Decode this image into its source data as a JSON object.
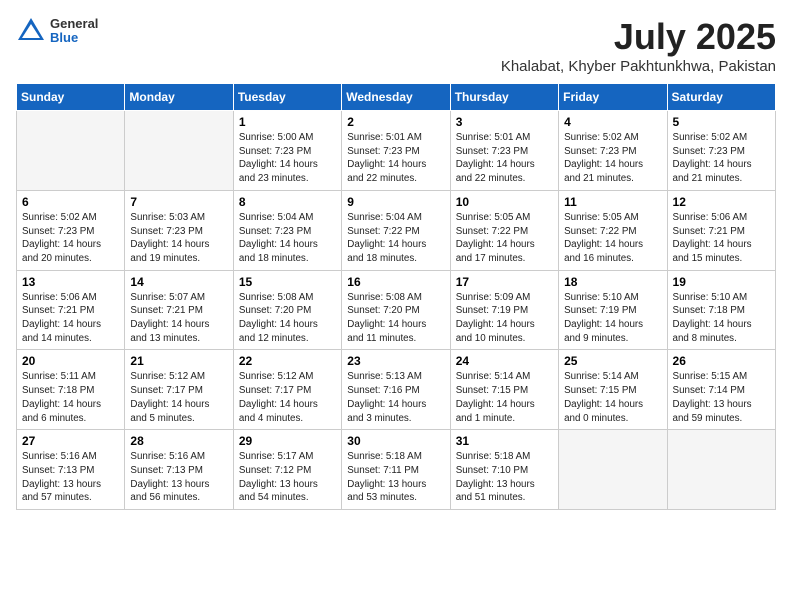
{
  "header": {
    "logo_general": "General",
    "logo_blue": "Blue",
    "month": "July 2025",
    "location": "Khalabat, Khyber Pakhtunkhwa, Pakistan"
  },
  "days_of_week": [
    "Sunday",
    "Monday",
    "Tuesday",
    "Wednesday",
    "Thursday",
    "Friday",
    "Saturday"
  ],
  "weeks": [
    [
      {
        "day": null
      },
      {
        "day": null
      },
      {
        "day": "1",
        "sunrise": "Sunrise: 5:00 AM",
        "sunset": "Sunset: 7:23 PM",
        "daylight": "Daylight: 14 hours and 23 minutes."
      },
      {
        "day": "2",
        "sunrise": "Sunrise: 5:01 AM",
        "sunset": "Sunset: 7:23 PM",
        "daylight": "Daylight: 14 hours and 22 minutes."
      },
      {
        "day": "3",
        "sunrise": "Sunrise: 5:01 AM",
        "sunset": "Sunset: 7:23 PM",
        "daylight": "Daylight: 14 hours and 22 minutes."
      },
      {
        "day": "4",
        "sunrise": "Sunrise: 5:02 AM",
        "sunset": "Sunset: 7:23 PM",
        "daylight": "Daylight: 14 hours and 21 minutes."
      },
      {
        "day": "5",
        "sunrise": "Sunrise: 5:02 AM",
        "sunset": "Sunset: 7:23 PM",
        "daylight": "Daylight: 14 hours and 21 minutes."
      }
    ],
    [
      {
        "day": "6",
        "sunrise": "Sunrise: 5:02 AM",
        "sunset": "Sunset: 7:23 PM",
        "daylight": "Daylight: 14 hours and 20 minutes."
      },
      {
        "day": "7",
        "sunrise": "Sunrise: 5:03 AM",
        "sunset": "Sunset: 7:23 PM",
        "daylight": "Daylight: 14 hours and 19 minutes."
      },
      {
        "day": "8",
        "sunrise": "Sunrise: 5:04 AM",
        "sunset": "Sunset: 7:23 PM",
        "daylight": "Daylight: 14 hours and 18 minutes."
      },
      {
        "day": "9",
        "sunrise": "Sunrise: 5:04 AM",
        "sunset": "Sunset: 7:22 PM",
        "daylight": "Daylight: 14 hours and 18 minutes."
      },
      {
        "day": "10",
        "sunrise": "Sunrise: 5:05 AM",
        "sunset": "Sunset: 7:22 PM",
        "daylight": "Daylight: 14 hours and 17 minutes."
      },
      {
        "day": "11",
        "sunrise": "Sunrise: 5:05 AM",
        "sunset": "Sunset: 7:22 PM",
        "daylight": "Daylight: 14 hours and 16 minutes."
      },
      {
        "day": "12",
        "sunrise": "Sunrise: 5:06 AM",
        "sunset": "Sunset: 7:21 PM",
        "daylight": "Daylight: 14 hours and 15 minutes."
      }
    ],
    [
      {
        "day": "13",
        "sunrise": "Sunrise: 5:06 AM",
        "sunset": "Sunset: 7:21 PM",
        "daylight": "Daylight: 14 hours and 14 minutes."
      },
      {
        "day": "14",
        "sunrise": "Sunrise: 5:07 AM",
        "sunset": "Sunset: 7:21 PM",
        "daylight": "Daylight: 14 hours and 13 minutes."
      },
      {
        "day": "15",
        "sunrise": "Sunrise: 5:08 AM",
        "sunset": "Sunset: 7:20 PM",
        "daylight": "Daylight: 14 hours and 12 minutes."
      },
      {
        "day": "16",
        "sunrise": "Sunrise: 5:08 AM",
        "sunset": "Sunset: 7:20 PM",
        "daylight": "Daylight: 14 hours and 11 minutes."
      },
      {
        "day": "17",
        "sunrise": "Sunrise: 5:09 AM",
        "sunset": "Sunset: 7:19 PM",
        "daylight": "Daylight: 14 hours and 10 minutes."
      },
      {
        "day": "18",
        "sunrise": "Sunrise: 5:10 AM",
        "sunset": "Sunset: 7:19 PM",
        "daylight": "Daylight: 14 hours and 9 minutes."
      },
      {
        "day": "19",
        "sunrise": "Sunrise: 5:10 AM",
        "sunset": "Sunset: 7:18 PM",
        "daylight": "Daylight: 14 hours and 8 minutes."
      }
    ],
    [
      {
        "day": "20",
        "sunrise": "Sunrise: 5:11 AM",
        "sunset": "Sunset: 7:18 PM",
        "daylight": "Daylight: 14 hours and 6 minutes."
      },
      {
        "day": "21",
        "sunrise": "Sunrise: 5:12 AM",
        "sunset": "Sunset: 7:17 PM",
        "daylight": "Daylight: 14 hours and 5 minutes."
      },
      {
        "day": "22",
        "sunrise": "Sunrise: 5:12 AM",
        "sunset": "Sunset: 7:17 PM",
        "daylight": "Daylight: 14 hours and 4 minutes."
      },
      {
        "day": "23",
        "sunrise": "Sunrise: 5:13 AM",
        "sunset": "Sunset: 7:16 PM",
        "daylight": "Daylight: 14 hours and 3 minutes."
      },
      {
        "day": "24",
        "sunrise": "Sunrise: 5:14 AM",
        "sunset": "Sunset: 7:15 PM",
        "daylight": "Daylight: 14 hours and 1 minute."
      },
      {
        "day": "25",
        "sunrise": "Sunrise: 5:14 AM",
        "sunset": "Sunset: 7:15 PM",
        "daylight": "Daylight: 14 hours and 0 minutes."
      },
      {
        "day": "26",
        "sunrise": "Sunrise: 5:15 AM",
        "sunset": "Sunset: 7:14 PM",
        "daylight": "Daylight: 13 hours and 59 minutes."
      }
    ],
    [
      {
        "day": "27",
        "sunrise": "Sunrise: 5:16 AM",
        "sunset": "Sunset: 7:13 PM",
        "daylight": "Daylight: 13 hours and 57 minutes."
      },
      {
        "day": "28",
        "sunrise": "Sunrise: 5:16 AM",
        "sunset": "Sunset: 7:13 PM",
        "daylight": "Daylight: 13 hours and 56 minutes."
      },
      {
        "day": "29",
        "sunrise": "Sunrise: 5:17 AM",
        "sunset": "Sunset: 7:12 PM",
        "daylight": "Daylight: 13 hours and 54 minutes."
      },
      {
        "day": "30",
        "sunrise": "Sunrise: 5:18 AM",
        "sunset": "Sunset: 7:11 PM",
        "daylight": "Daylight: 13 hours and 53 minutes."
      },
      {
        "day": "31",
        "sunrise": "Sunrise: 5:18 AM",
        "sunset": "Sunset: 7:10 PM",
        "daylight": "Daylight: 13 hours and 51 minutes."
      },
      {
        "day": null
      },
      {
        "day": null
      }
    ]
  ]
}
